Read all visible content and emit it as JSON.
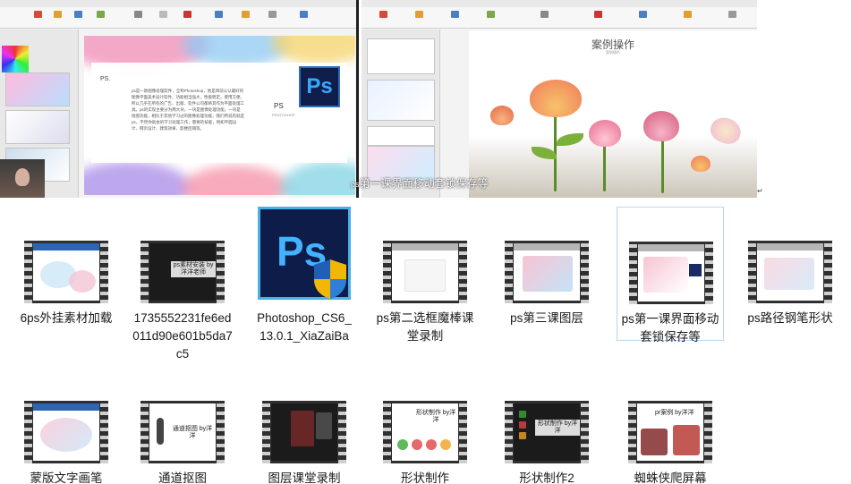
{
  "top_image": {
    "left_slide": {
      "heading": "PS.",
      "body": "ps是一款图像处理软件，全称Photoshop，他是目前公认最好的图像平面美术设计软件，功能相当强大，性能稳定，使用方便，所以几乎在所有的广告、出版、软件公司都将其作为平面处理工具。ps的实现主要分为两大块，一块是图像处理功能，一块是绘图功能，相比于其他学习过的图像处理功能，我们所说的就是ps，不然你就会的学习处理工作，需要的技能，例如平面设计、网页设计、建筑效果、影楼后期等。",
      "logo_text": "Ps",
      "caption": "PS",
      "subcaption": "PHOTOSHOP"
    },
    "right_slide": {
      "title": "案例操作",
      "subtitle": "案例操作"
    },
    "subtitle_overlay_prefix": "ps",
    "subtitle_overlay": "第一课界面移动套锁保存等",
    "end_mark": "↵"
  },
  "files": [
    {
      "name": "6ps外挂素材加载",
      "thumb_text": "",
      "type": "video-light"
    },
    {
      "name": "1735552231fe6ed011d90e601b5da7c5",
      "thumb_text": "ps素材安装 by洋洋老师",
      "type": "video-dark"
    },
    {
      "name": "Photoshop_CS6_13.0.1_XiaZaiBa",
      "thumb_text": "Ps",
      "type": "installer"
    },
    {
      "name": "ps第二选框魔棒课堂录制",
      "thumb_text": "",
      "type": "video-light"
    },
    {
      "name": "ps第三课图层",
      "thumb_text": "",
      "type": "video-light"
    },
    {
      "name": "ps第一课界面移动套锁保存等",
      "thumb_text": "",
      "type": "video-light"
    },
    {
      "name": "ps路径钢笔形状",
      "thumb_text": "",
      "type": "video-light"
    },
    {
      "name": "蒙版文字画笔",
      "thumb_text": "",
      "type": "video-light"
    },
    {
      "name": "通道抠图",
      "thumb_text": "通道抠图 by洋洋",
      "type": "video-light"
    },
    {
      "name": "图层课堂录制",
      "thumb_text": "",
      "type": "video-dark"
    },
    {
      "name": "形状制作",
      "thumb_text": "形状制作 by洋洋",
      "type": "video-light"
    },
    {
      "name": "形状制作2",
      "thumb_text": "形状制作 by洋洋",
      "type": "video-dark"
    },
    {
      "name": "蜘蛛侠爬屏幕",
      "thumb_text": "pr案例 by洋洋",
      "type": "video-light"
    }
  ],
  "colors": {
    "selection_border": "#b9d7f2",
    "ps_blue": "#43b3ff",
    "ps_dark": "#0d1c48"
  }
}
